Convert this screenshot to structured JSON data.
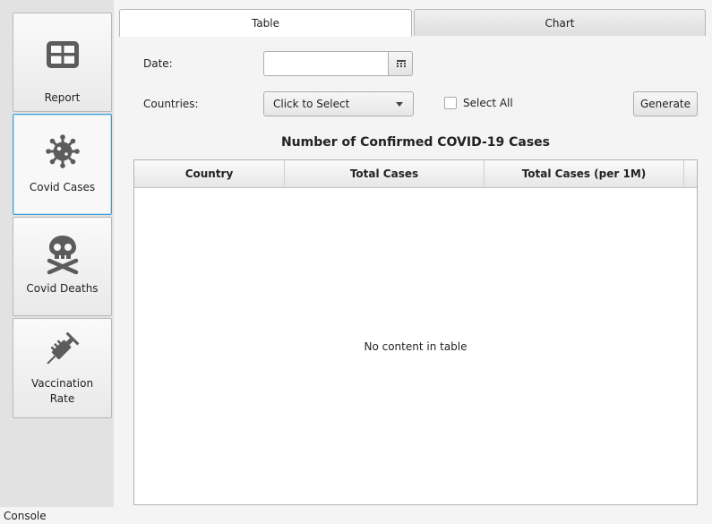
{
  "sidebar": {
    "items": [
      {
        "label": "Report",
        "icon": "table-grid-icon",
        "active": false
      },
      {
        "label": "Covid Cases",
        "icon": "virus-icon",
        "active": true
      },
      {
        "label": "Covid Deaths",
        "icon": "skull-crossbones-icon",
        "active": false
      },
      {
        "label": "Vaccination\nRate",
        "icon": "syringe-icon",
        "active": false
      }
    ]
  },
  "tabs": [
    {
      "label": "Table",
      "selected": true
    },
    {
      "label": "Chart",
      "selected": false
    }
  ],
  "form": {
    "date_label": "Date:",
    "date_value": "",
    "countries_label": "Countries:",
    "countries_select_value": "Click to Select",
    "select_all_label": "Select All",
    "select_all_checked": false,
    "generate_label": "Generate"
  },
  "table": {
    "title": "Number of Confirmed COVID-19 Cases",
    "columns": [
      "Country",
      "Total Cases",
      "Total Cases (per 1M)"
    ],
    "rows": [],
    "empty_message": "No content in table"
  },
  "footer": {
    "console_label": "Console"
  },
  "colors": {
    "icon_gray": "#5c5c5c",
    "active_border": "#3aa0d8"
  }
}
